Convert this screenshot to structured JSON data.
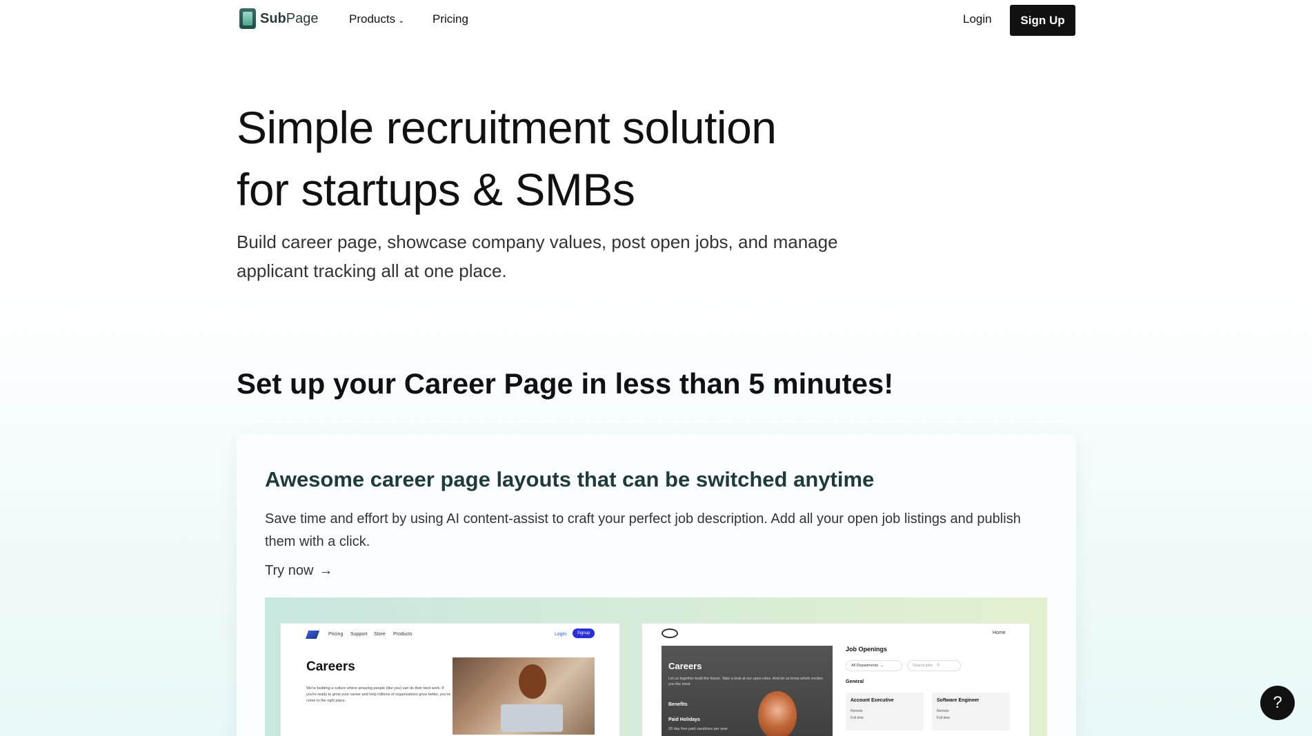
{
  "nav": {
    "logo_bold": "Sub",
    "logo_rest": "Page",
    "products_label": "Products",
    "pricing_label": "Pricing",
    "login_label": "Login",
    "signup_label": "Sign Up"
  },
  "hero": {
    "title_line1": "Simple recruitment solution",
    "title_line2": "for startups & SMBs",
    "subtitle": "Build career page, showcase company values, post open jobs, and manage applicant tracking all at one place."
  },
  "section": {
    "title": "Set up your Career Page in less than 5 minutes!"
  },
  "card": {
    "title": "Awesome career page layouts that can be switched anytime",
    "description": "Save time and effort by using AI content-assist to craft your perfect job description. Add all your open job listings and publish them with a click.",
    "cta": "Try now",
    "cta_arrow": "→"
  },
  "mock1": {
    "nav_items": [
      "Pricing",
      "Support",
      "Store",
      "Products"
    ],
    "login": "Login",
    "signup": "Signup",
    "careers": "Careers",
    "text": "We're building a culture where amazing people (like you) can do their best work. If you're ready to grow your career and help millions of organizations grow better, you've come to the right place."
  },
  "mock2": {
    "home": "Home",
    "careers": "Careers",
    "hero_text": "Let us together build the future. Take a look at our open roles. And let us know which excites you the most",
    "benefits": "Benefits",
    "paid_holidays": "Paid Holidays",
    "paid_sub": "20 day free paid vacations per year",
    "job_openings": "Job Openings",
    "dept_select": "All Departments",
    "search_placeholder": "Search jobs",
    "general": "General",
    "jobs": [
      {
        "title": "Account Executive",
        "location": "Remote",
        "type": "Full time"
      },
      {
        "title": "Software Engineer",
        "location": "Remote",
        "type": "Full time"
      }
    ]
  },
  "help": {
    "label": "?"
  }
}
